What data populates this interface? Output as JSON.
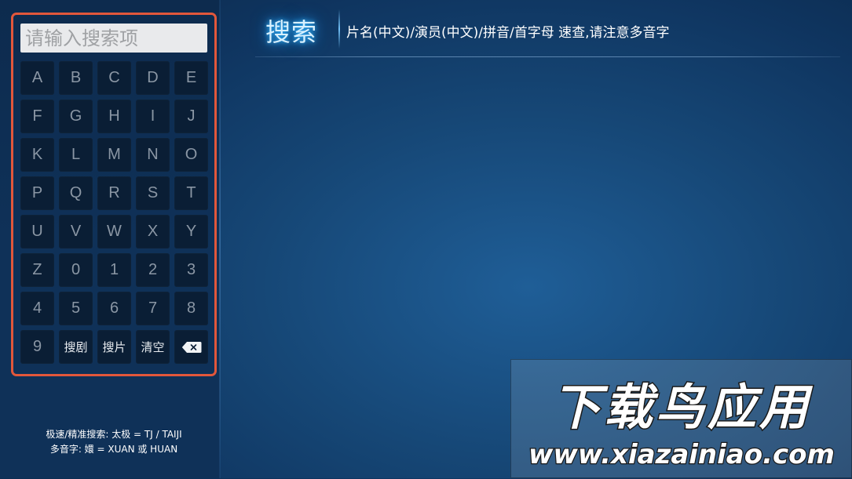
{
  "page": {
    "title": "搜索",
    "hint": "片名(中文)/演员(中文)/拼音/首字母 速查,请注意多音字"
  },
  "keyboard": {
    "placeholder": "请输入搜索项",
    "keys": [
      "A",
      "B",
      "C",
      "D",
      "E",
      "F",
      "G",
      "H",
      "I",
      "J",
      "K",
      "L",
      "M",
      "N",
      "O",
      "P",
      "Q",
      "R",
      "S",
      "T",
      "U",
      "V",
      "W",
      "X",
      "Y",
      "Z",
      "0",
      "1",
      "2",
      "3",
      "4",
      "5",
      "6",
      "7",
      "8",
      "9"
    ],
    "search_drama_label": "搜剧",
    "search_movie_label": "搜片",
    "clear_label": "清空",
    "backspace_icon": "backspace-icon"
  },
  "tips": {
    "line1": "极速/精准搜索: 太极 = TJ / TAIJI",
    "line2": "多音字: 嬛 = XUAN 或 HUAN"
  },
  "watermark": {
    "brand": "下载鸟应用",
    "url": "www.xiazainiao.com"
  },
  "colors": {
    "frame_accent": "#e2573b",
    "title_glow": "#35b8ff",
    "key_bg": "#0a1e35"
  }
}
